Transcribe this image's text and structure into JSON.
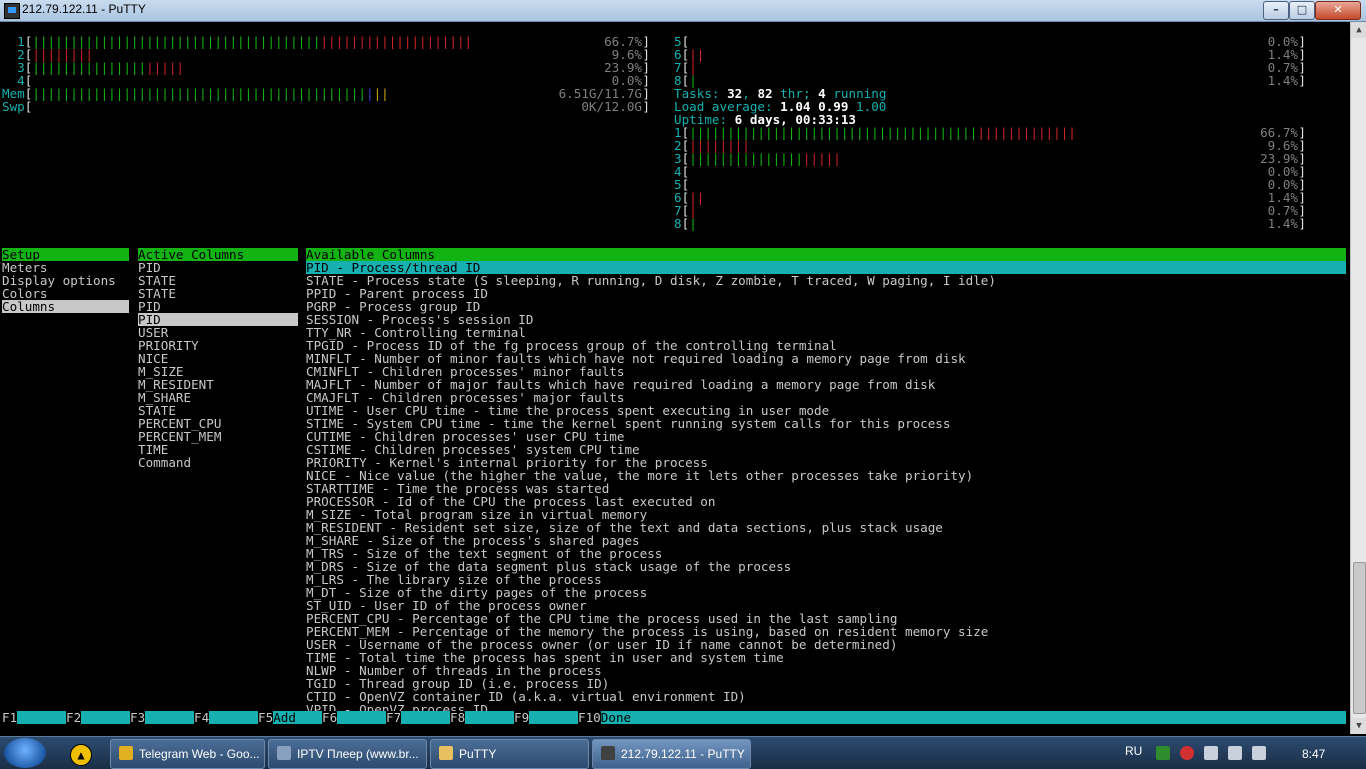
{
  "window": {
    "title": "212.79.122.11 - PuTTY"
  },
  "meters_left": [
    {
      "label": "1",
      "bars": [
        [
          "g",
          "||||||||||||||||||||||||||||||||||||||"
        ],
        [
          "r",
          "||||||||||||||||||||"
        ]
      ],
      "value": "66.7%"
    },
    {
      "label": "2",
      "bars": [
        [
          "r",
          "||||||||"
        ]
      ],
      "value": "9.6%"
    },
    {
      "label": "3",
      "bars": [
        [
          "g",
          "|||||||||||||||"
        ],
        [
          "r",
          "|||||"
        ]
      ],
      "value": "23.9%"
    },
    {
      "label": "4",
      "bars": [],
      "value": "0.0%"
    },
    {
      "label": "Mem",
      "bars": [
        [
          "g",
          "||||||||||||||||||||||||||||||||||||||||||||"
        ],
        [
          "b",
          "|"
        ],
        [
          "y",
          "||"
        ]
      ],
      "value": "6.51G/11.7G"
    },
    {
      "label": "Swp",
      "bars": [],
      "value": "0K/12.0G"
    }
  ],
  "meters_right_top": [
    {
      "label": "5",
      "bars": [],
      "value": "0.0%"
    },
    {
      "label": "6",
      "bars": [
        [
          "r",
          "||"
        ]
      ],
      "value": "1.4%"
    },
    {
      "label": "7",
      "bars": [
        [
          "r",
          "|"
        ]
      ],
      "value": "0.7%"
    },
    {
      "label": "8",
      "bars": [
        [
          "g",
          "|"
        ]
      ],
      "value": "1.4%"
    }
  ],
  "tasks": {
    "label": "Tasks:",
    "procs": "32",
    "threads": "82",
    "thr_label": "thr;",
    "running": "4",
    "running_label": "running"
  },
  "load": {
    "label": "Load average:",
    "v1": "1.04",
    "v5": "0.99",
    "v15": "1.00"
  },
  "uptime": {
    "label": "Uptime:",
    "value": "6 days, 00:33:13"
  },
  "meters_right_bottom": [
    {
      "label": "1",
      "bars": [
        [
          "g",
          "||||||||||||||||||||||||||||||||||||||"
        ],
        [
          "r",
          "|||||||||||||"
        ]
      ],
      "value": "66.7%"
    },
    {
      "label": "2",
      "bars": [
        [
          "r",
          "||||||||"
        ]
      ],
      "value": "9.6%"
    },
    {
      "label": "3",
      "bars": [
        [
          "g",
          "|||||||||||||||"
        ],
        [
          "r",
          "|||||"
        ]
      ],
      "value": "23.9%"
    },
    {
      "label": "4",
      "bars": [],
      "value": "0.0%"
    },
    {
      "label": "5",
      "bars": [],
      "value": "0.0%"
    },
    {
      "label": "6",
      "bars": [
        [
          "r",
          "||"
        ]
      ],
      "value": "1.4%"
    },
    {
      "label": "7",
      "bars": [
        [
          "r",
          "|"
        ]
      ],
      "value": "0.7%"
    },
    {
      "label": "8",
      "bars": [
        [
          "g",
          "|"
        ]
      ],
      "value": "1.4%"
    }
  ],
  "setup": {
    "header": "Setup",
    "items": [
      "Meters",
      "Display options",
      "Colors",
      "Columns"
    ],
    "selected": 3
  },
  "active_columns": {
    "header": "Active Columns",
    "items": [
      "PID",
      "STATE",
      "STATE",
      "PID",
      "PID",
      "USER",
      "PRIORITY",
      "NICE",
      "M_SIZE",
      "M_RESIDENT",
      "M_SHARE",
      "STATE",
      "PERCENT_CPU",
      "PERCENT_MEM",
      "TIME",
      "Command"
    ],
    "selected": 4
  },
  "available_columns": {
    "header": "Available Columns",
    "items": [
      "PID - Process/thread ID",
      "STATE - Process state (S sleeping, R running, D disk, Z zombie, T traced, W paging, I idle)",
      "PPID - Parent process ID",
      "PGRP - Process group ID",
      "SESSION - Process's session ID",
      "TTY_NR - Controlling terminal",
      "TPGID - Process ID of the fg process group of the controlling terminal",
      "MINFLT - Number of minor faults which have not required loading a memory page from disk",
      "CMINFLT - Children processes' minor faults",
      "MAJFLT - Number of major faults which have required loading a memory page from disk",
      "CMAJFLT - Children processes' major faults",
      "UTIME - User CPU time - time the process spent executing in user mode",
      "STIME - System CPU time - time the kernel spent running system calls for this process",
      "CUTIME - Children processes' user CPU time",
      "CSTIME - Children processes' system CPU time",
      "PRIORITY - Kernel's internal priority for the process",
      "NICE - Nice value (the higher the value, the more it lets other processes take priority)",
      "STARTTIME - Time the process was started",
      "PROCESSOR - Id of the CPU the process last executed on",
      "M_SIZE - Total program size in virtual memory",
      "M_RESIDENT - Resident set size, size of the text and data sections, plus stack usage",
      "M_SHARE - Size of the process's shared pages",
      "M_TRS - Size of the text segment of the process",
      "M_DRS - Size of the data segment plus stack usage of the process",
      "M_LRS - The library size of the process",
      "M_DT - Size of the dirty pages of the process",
      "ST_UID - User ID of the process owner",
      "PERCENT_CPU - Percentage of the CPU time the process used in the last sampling",
      "PERCENT_MEM - Percentage of the memory the process is using, based on resident memory size",
      "USER - Username of the process owner (or user ID if name cannot be determined)",
      "TIME - Total time the process has spent in user and system time",
      "NLWP - Number of threads in the process",
      "TGID - Thread group ID (i.e. process ID)",
      "CTID - OpenVZ container ID (a.k.a. virtual environment ID)",
      "VPID - OpenVZ process ID"
    ],
    "selected": 0
  },
  "function_keys": [
    {
      "key": "F1",
      "label": ""
    },
    {
      "key": "F2",
      "label": ""
    },
    {
      "key": "F3",
      "label": ""
    },
    {
      "key": "F4",
      "label": ""
    },
    {
      "key": "F5",
      "label": "Add"
    },
    {
      "key": "F6",
      "label": ""
    },
    {
      "key": "F7",
      "label": ""
    },
    {
      "key": "F8",
      "label": ""
    },
    {
      "key": "F9",
      "label": ""
    },
    {
      "key": "F10",
      "label": "Done"
    }
  ],
  "taskbar": {
    "items": [
      {
        "label": "Telegram Web - Goo...",
        "icon": "chrome-icon",
        "color": "#e0b020"
      },
      {
        "label": "IPTV Плеер (www.br...",
        "icon": "iptv-icon",
        "color": "#8aa0c0"
      },
      {
        "label": "PuTTY",
        "icon": "folder-icon",
        "color": "#e8c060"
      },
      {
        "label": "212.79.122.11 - PuTTY",
        "icon": "putty-icon",
        "color": "#404040"
      }
    ],
    "lang": "RU",
    "clock": "8:47"
  },
  "colors": {
    "green": "#12b312",
    "cyan": "#16b0b0",
    "red": "#cc2222"
  }
}
